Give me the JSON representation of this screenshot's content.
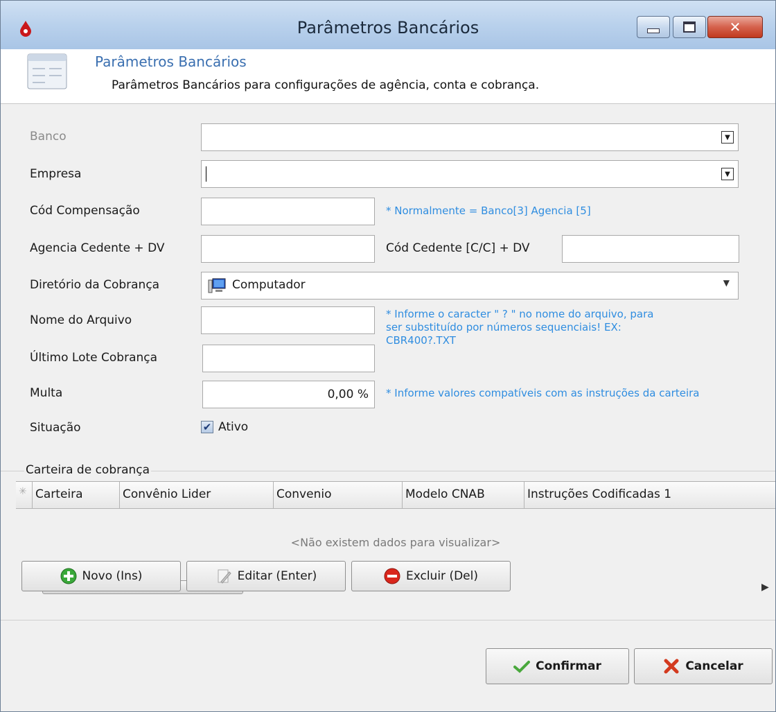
{
  "window": {
    "title": "Parâmetros Bancários",
    "close_glyph": "✕"
  },
  "header": {
    "title": "Parâmetros Bancários",
    "subtitle": "Parâmetros Bancários para configurações de agência, conta e cobrança."
  },
  "form": {
    "banco_label": "Banco",
    "banco_value": "",
    "empresa_label": "Empresa",
    "empresa_value": "",
    "cod_compensacao_label": "Cód Compensação",
    "cod_compensacao_value": "",
    "cod_compensacao_hint": "* Normalmente  = Banco[3] Agencia [5]",
    "agencia_label": "Agencia Cedente + DV",
    "agencia_value": "",
    "cod_cedente_label": "Cód Cedente [C/C] + DV",
    "cod_cedente_value": "",
    "diretorio_label": "Diretório da Cobrança",
    "diretorio_value": "Computador",
    "nome_arquivo_label": "Nome do Arquivo",
    "nome_arquivo_value": "",
    "nome_arquivo_hint_1": "* Informe o caracter \" ? \" no nome do arquivo, para",
    "nome_arquivo_hint_2": "ser substituído por números sequenciais! EX:",
    "nome_arquivo_hint_3": "CBR400?.TXT",
    "ultimo_lote_label": "Último Lote Cobrança",
    "ultimo_lote_value": "",
    "multa_label": "Multa",
    "multa_value": "0,00 %",
    "multa_hint": "* Informe valores compatíveis com as instruções da carteira",
    "situacao_label": "Situação",
    "ativo_label": "Ativo",
    "ativo_checked": true
  },
  "grid": {
    "group_label": "Carteira de cobrança",
    "columns": [
      "Carteira",
      "Convênio Lider",
      "Convenio",
      "Modelo CNAB",
      "Instruções Codificadas 1"
    ],
    "empty_text": "<Não existem dados para visualizar>"
  },
  "actions": {
    "novo": "Novo (Ins)",
    "editar": "Editar (Enter)",
    "excluir": "Excluir (Del)"
  },
  "footer": {
    "confirmar": "Confirmar",
    "cancelar": "Cancelar"
  },
  "colors": {
    "hint": "#2f8de0",
    "header_title": "#3a6fb0"
  }
}
